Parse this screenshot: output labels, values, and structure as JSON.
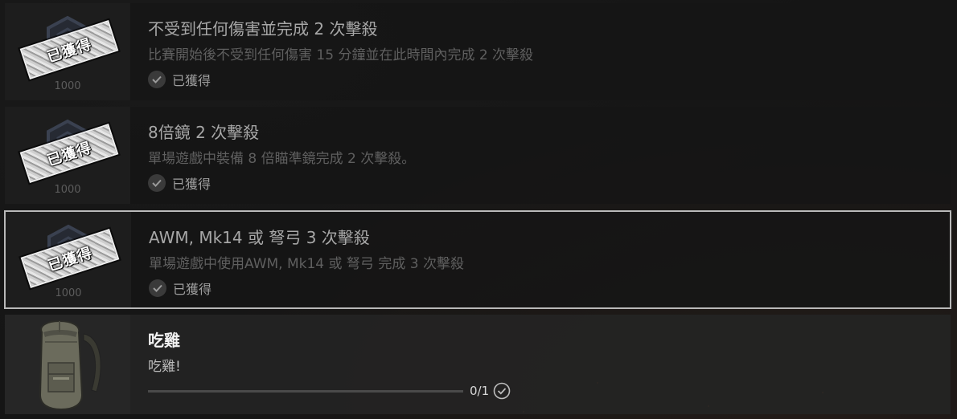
{
  "missions": [
    {
      "title": "不受到任何傷害並完成 2 次擊殺",
      "description": "比賽開始後不受到任何傷害 15 分鐘並在此時間內完成 2 次擊殺",
      "stamp": "已獲得",
      "points": "1000",
      "status": "已獲得",
      "emblem_icon": "hexagon-emblem-icon"
    },
    {
      "title": "8倍鏡 2 次擊殺",
      "description": "單場遊戲中裝備 8 倍瞄準鏡完成 2 次擊殺。",
      "stamp": "已獲得",
      "points": "1000",
      "status": "已獲得",
      "emblem_icon": "hexagon-emblem-icon"
    },
    {
      "title": "AWM, Mk14 或 弩弓 3 次擊殺",
      "description": "單場遊戲中使用AWM, Mk14 或 弩弓 完成 3 次擊殺",
      "stamp": "已獲得",
      "points": "1000",
      "status": "已獲得",
      "emblem_icon": "hexagon-emblem-icon"
    },
    {
      "title": "吃雞",
      "description": "吃雞!",
      "progress_text": "0/1",
      "progress_fraction": 0,
      "reward_icon": "backpack-icon"
    }
  ],
  "colors": {
    "selected_border": "#b9b9b9",
    "ember": "#c0602a"
  }
}
